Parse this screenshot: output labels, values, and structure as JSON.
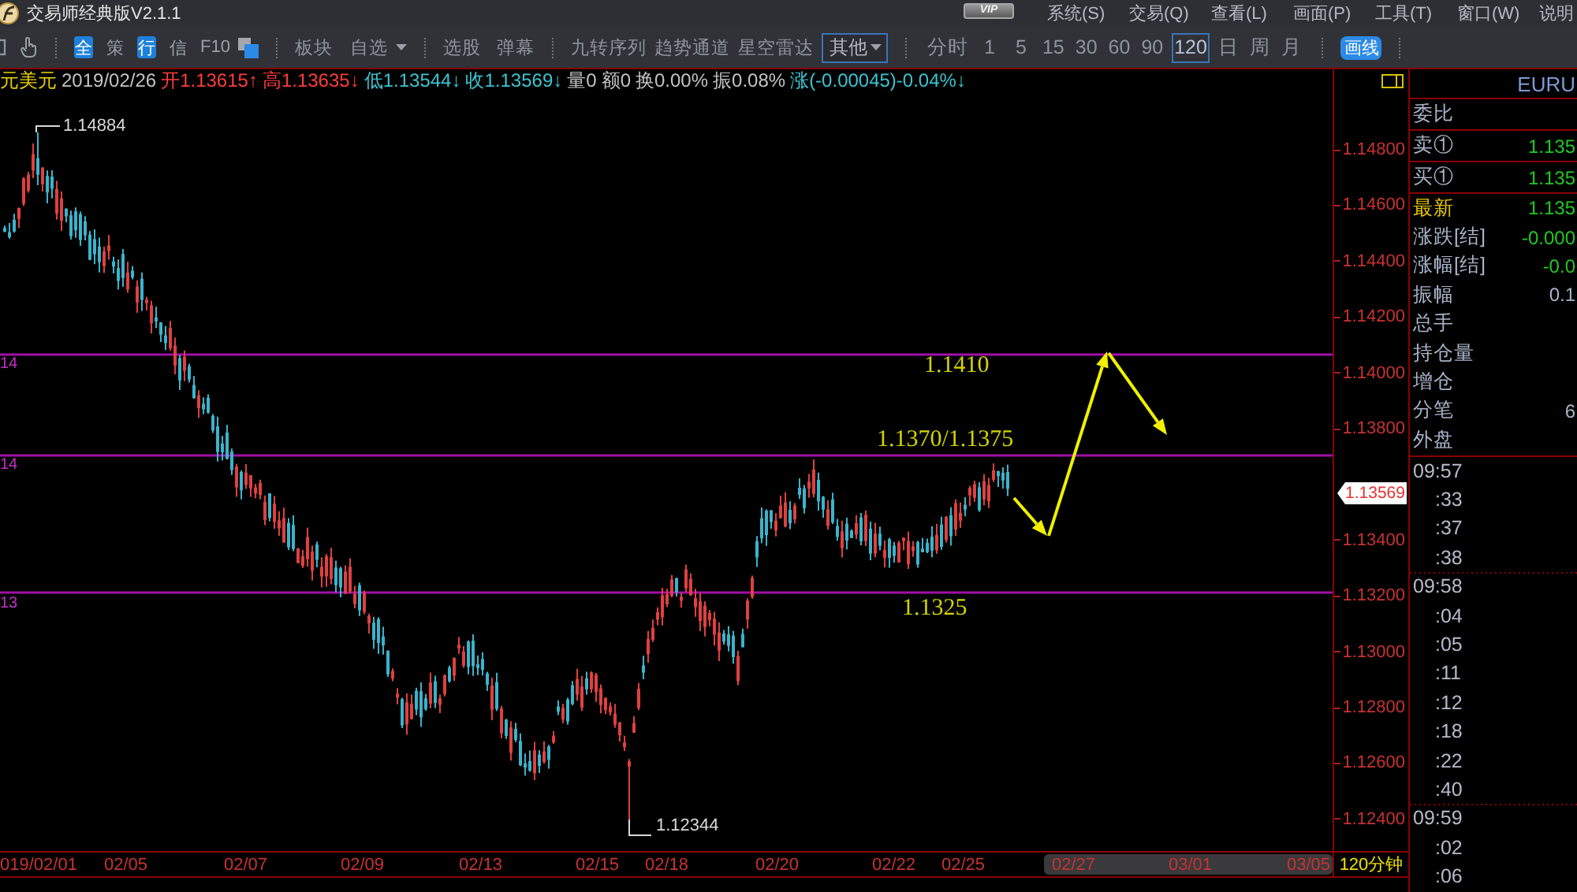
{
  "window": {
    "title": "交易师经典版V2.1.1",
    "badge": "VIP",
    "menus": [
      "系统(S)",
      "交易(Q)",
      "查看(L)",
      "画面(P)",
      "工具(T)",
      "窗口(W)",
      "说明"
    ]
  },
  "toolbar": {
    "groups": [
      {
        "items": [
          {
            "kind": "badge",
            "label": "全",
            "highlighted": true
          },
          {
            "kind": "badge",
            "label": "策",
            "highlighted": false
          },
          {
            "kind": "badge",
            "label": "行",
            "highlighted": true
          },
          {
            "kind": "badge",
            "label": "信",
            "highlighted": false
          },
          {
            "kind": "badge",
            "label": "F10",
            "highlighted": false
          }
        ]
      },
      {
        "items": [
          {
            "kind": "button",
            "label": "板块"
          },
          {
            "kind": "dropdown",
            "label": "自选"
          }
        ]
      },
      {
        "items": [
          {
            "kind": "button",
            "label": "选股"
          },
          {
            "kind": "button",
            "label": "弹幕"
          }
        ]
      },
      {
        "items": [
          {
            "kind": "button",
            "label": "九转序列"
          },
          {
            "kind": "button",
            "label": "趋势通道"
          },
          {
            "kind": "button",
            "label": "星空雷达"
          },
          {
            "kind": "select",
            "label": "其他"
          }
        ]
      },
      {
        "items": [
          {
            "kind": "period",
            "label": "分时",
            "selected": false
          },
          {
            "kind": "period",
            "label": "1",
            "selected": false
          },
          {
            "kind": "period",
            "label": "5",
            "selected": false
          },
          {
            "kind": "period",
            "label": "15",
            "selected": false
          },
          {
            "kind": "period",
            "label": "30",
            "selected": false
          },
          {
            "kind": "period",
            "label": "60",
            "selected": false
          },
          {
            "kind": "period",
            "label": "90",
            "selected": false
          },
          {
            "kind": "period",
            "label": "120",
            "selected": true
          },
          {
            "kind": "period",
            "label": "日",
            "selected": false
          },
          {
            "kind": "period",
            "label": "周",
            "selected": false
          },
          {
            "kind": "period",
            "label": "月",
            "selected": false
          }
        ]
      },
      {
        "items": [
          {
            "kind": "pill",
            "label": "画线"
          }
        ]
      }
    ]
  },
  "quote_line": [
    {
      "kind": "symbol",
      "text": "元美元"
    },
    {
      "kind": "date",
      "text": "2019/02/26"
    },
    {
      "kind": "up",
      "text": "开1.13615↑"
    },
    {
      "kind": "up",
      "text": "高1.13635↓"
    },
    {
      "kind": "down",
      "text": "低1.13544↓"
    },
    {
      "kind": "down",
      "text": "收1.13569↓"
    },
    {
      "kind": "stat",
      "text": "量0"
    },
    {
      "kind": "stat",
      "text": "额0"
    },
    {
      "kind": "stat",
      "text": "换0.00%"
    },
    {
      "kind": "stat",
      "text": "振0.08%"
    },
    {
      "kind": "down",
      "text": "涨(-0.00045)-0.04%↓"
    }
  ],
  "chart": {
    "high_label": "1.14884",
    "low_label": "1.12344",
    "levels": [
      {
        "edge_label": "14",
        "note": "1.1410"
      },
      {
        "edge_label": "14",
        "note": "1.1370/1.1375"
      },
      {
        "edge_label": "13",
        "note": "1.1325"
      }
    ]
  },
  "price_axis": [
    {
      "kind": "tick",
      "text": "1.14800"
    },
    {
      "kind": "tick",
      "text": "1.14600"
    },
    {
      "kind": "tick",
      "text": "1.14400"
    },
    {
      "kind": "tick",
      "text": "1.14200"
    },
    {
      "kind": "tick",
      "text": "1.14000"
    },
    {
      "kind": "tick",
      "text": "1.13800"
    },
    {
      "kind": "current",
      "text": "1.13569"
    },
    {
      "kind": "tick",
      "text": "1.13400"
    },
    {
      "kind": "tick",
      "text": "1.13200"
    },
    {
      "kind": "tick",
      "text": "1.13000"
    },
    {
      "kind": "tick",
      "text": "1.12800"
    },
    {
      "kind": "tick",
      "text": "1.12600"
    },
    {
      "kind": "tick",
      "text": "1.12400"
    }
  ],
  "date_axis": {
    "dates": [
      {
        "text": "019/02/01",
        "future": false
      },
      {
        "text": "02/05",
        "future": false
      },
      {
        "text": "02/07",
        "future": false
      },
      {
        "text": "02/09",
        "future": false
      },
      {
        "text": "02/13",
        "future": false
      },
      {
        "text": "02/15",
        "future": false
      },
      {
        "text": "02/18",
        "future": false
      },
      {
        "text": "02/20",
        "future": false
      },
      {
        "text": "02/22",
        "future": false
      },
      {
        "text": "02/25",
        "future": false
      },
      {
        "text": "02/27",
        "future": true
      },
      {
        "text": "03/01",
        "future": true
      },
      {
        "text": "03/05",
        "future": true
      }
    ],
    "period": "120分钟"
  },
  "quote_panel": {
    "symbol": "EURU",
    "sections": [
      {
        "rows": [
          {
            "label": "委比",
            "highlighted": false
          }
        ]
      },
      {
        "rows": [
          {
            "label": "卖①",
            "value": "1.135",
            "falling": true,
            "highlighted": false
          }
        ]
      },
      {
        "rows": [
          {
            "label": "买①",
            "value": "1.135",
            "falling": true,
            "highlighted": false
          }
        ]
      },
      {
        "rows": [
          {
            "label": "最新",
            "value": "1.135",
            "falling": true,
            "highlighted": true
          },
          {
            "label": "涨跌[结]",
            "value": "-0.000",
            "falling": true,
            "highlighted": false
          },
          {
            "label": "涨幅[结]",
            "value": "-0.0",
            "falling": true,
            "highlighted": false
          },
          {
            "label": "振幅",
            "value": "0.1",
            "falling": false,
            "highlighted": false
          },
          {
            "label": "总手",
            "highlighted": false
          },
          {
            "label": "持仓量",
            "highlighted": false
          },
          {
            "label": "增仓",
            "highlighted": false
          },
          {
            "label": "分笔",
            "value": "6",
            "falling": false,
            "highlighted": false
          },
          {
            "label": "外盘",
            "highlighted": false
          }
        ]
      }
    ],
    "trades": [
      {
        "minute": "09:57",
        "seconds": [
          ":33",
          ":37",
          ":38"
        ]
      },
      {
        "minute": "09:58",
        "seconds": [
          ":04",
          ":05",
          ":11",
          ":12",
          ":18",
          ":22",
          ":40"
        ]
      },
      {
        "minute": "09:59",
        "seconds": [
          ":02",
          ":06"
        ]
      }
    ]
  }
}
